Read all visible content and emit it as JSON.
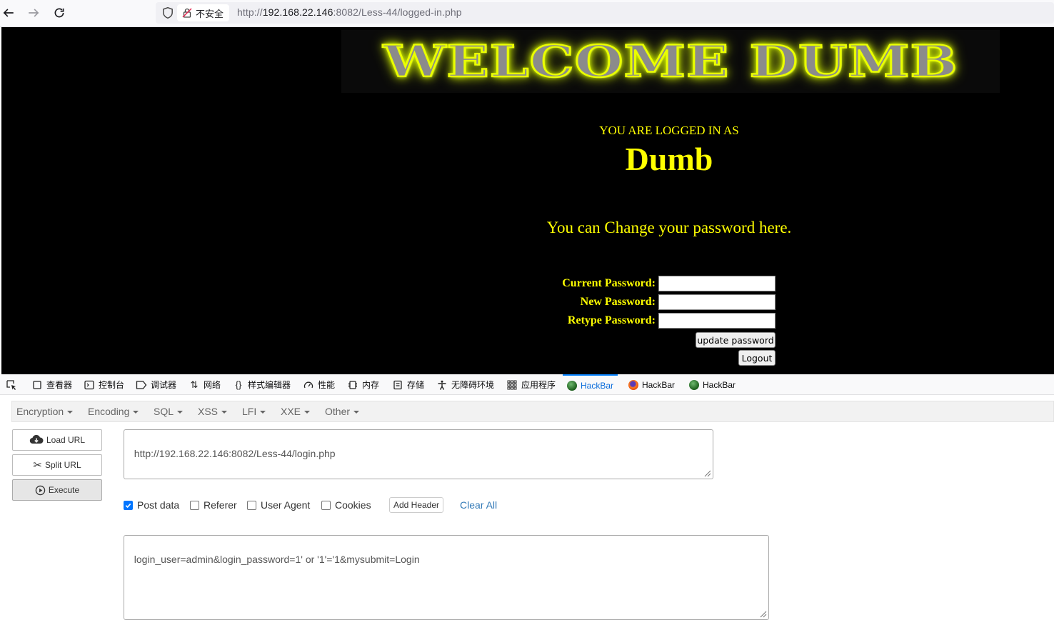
{
  "browser": {
    "security_label": "不安全",
    "url_scheme": "http://",
    "url_host": "192.168.22.146",
    "url_rest": ":8082/Less-44/logged-in.php"
  },
  "page": {
    "banner": "WELCOME DUMB",
    "logged_in_as": "YOU ARE LOGGED IN AS",
    "username": "Dumb",
    "change_message": "You can Change your password here.",
    "current_password_label": "Current Password:",
    "new_password_label": "New Password:",
    "retype_password_label": "Retype Password:",
    "update_button": "update password",
    "logout_button": "Logout"
  },
  "devtools": {
    "tabs": [
      {
        "label": "查看器",
        "icon": "inspector-icon"
      },
      {
        "label": "控制台",
        "icon": "console-icon"
      },
      {
        "label": "调试器",
        "icon": "debugger-icon"
      },
      {
        "label": "网络",
        "icon": "network-icon"
      },
      {
        "label": "样式编辑器",
        "icon": "style-editor-icon"
      },
      {
        "label": "性能",
        "icon": "performance-icon"
      },
      {
        "label": "内存",
        "icon": "memory-icon"
      },
      {
        "label": "存储",
        "icon": "storage-icon"
      },
      {
        "label": "无障碍环境",
        "icon": "accessibility-icon"
      },
      {
        "label": "应用程序",
        "icon": "application-icon"
      },
      {
        "label": "HackBar",
        "icon": "hackbar-icon",
        "active": true
      },
      {
        "label": "HackBar",
        "icon": "hackbar-firefox-icon"
      },
      {
        "label": "HackBar",
        "icon": "hackbar-icon"
      }
    ]
  },
  "hackbar": {
    "menu": [
      "Encryption",
      "Encoding",
      "SQL",
      "XSS",
      "LFI",
      "XXE",
      "Other"
    ],
    "load_url": "Load URL",
    "split_url": "Split URL",
    "execute": "Execute",
    "url_value": "http://192.168.22.146:8082/Less-44/login.php",
    "post_data_label": "Post data",
    "referer_label": "Referer",
    "user_agent_label": "User Agent",
    "cookies_label": "Cookies",
    "post_data_checked": true,
    "add_header": "Add Header",
    "clear_all": "Clear All",
    "post_body": "login_user=admin&login_password=1' or '1'='1&mysubmit=Login"
  },
  "colors": {
    "page_background": "#000000",
    "page_text": "#ffff00",
    "hackbar_link": "#337ab7",
    "devtools_active": "#0a84ff"
  }
}
